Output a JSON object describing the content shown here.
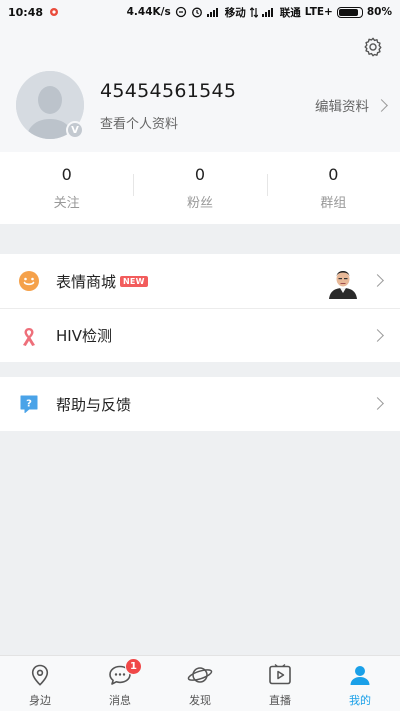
{
  "statusbar": {
    "time": "10:48",
    "speed": "4.44K/s",
    "carrier1": "移动",
    "carrier2": "联通",
    "network": "LTE+",
    "battery": "80%"
  },
  "profile": {
    "username": "45454561545",
    "view_profile": "查看个人资料",
    "edit_profile": "编辑资料",
    "badge": "V"
  },
  "stats": [
    {
      "value": "0",
      "label": "关注"
    },
    {
      "value": "0",
      "label": "粉丝"
    },
    {
      "value": "0",
      "label": "群组"
    }
  ],
  "menu": {
    "sticker_store": "表情商城",
    "new_badge": "NEW",
    "hiv_test": "HIV检测",
    "help_feedback": "帮助与反馈"
  },
  "tabs": [
    {
      "label": "身边",
      "icon": "location-pin-icon"
    },
    {
      "label": "消息",
      "icon": "chat-bubble-icon",
      "badge": "1"
    },
    {
      "label": "发现",
      "icon": "planet-icon"
    },
    {
      "label": "直播",
      "icon": "live-video-icon"
    },
    {
      "label": "我的",
      "icon": "person-icon"
    }
  ],
  "colors": {
    "accent": "#1aa0e8",
    "badge_red": "#f04848",
    "new_red": "#f25c5c",
    "emoji_orange": "#f5a14a",
    "ribbon_pink": "#ee6f7a",
    "help_blue": "#4aa3e8"
  }
}
